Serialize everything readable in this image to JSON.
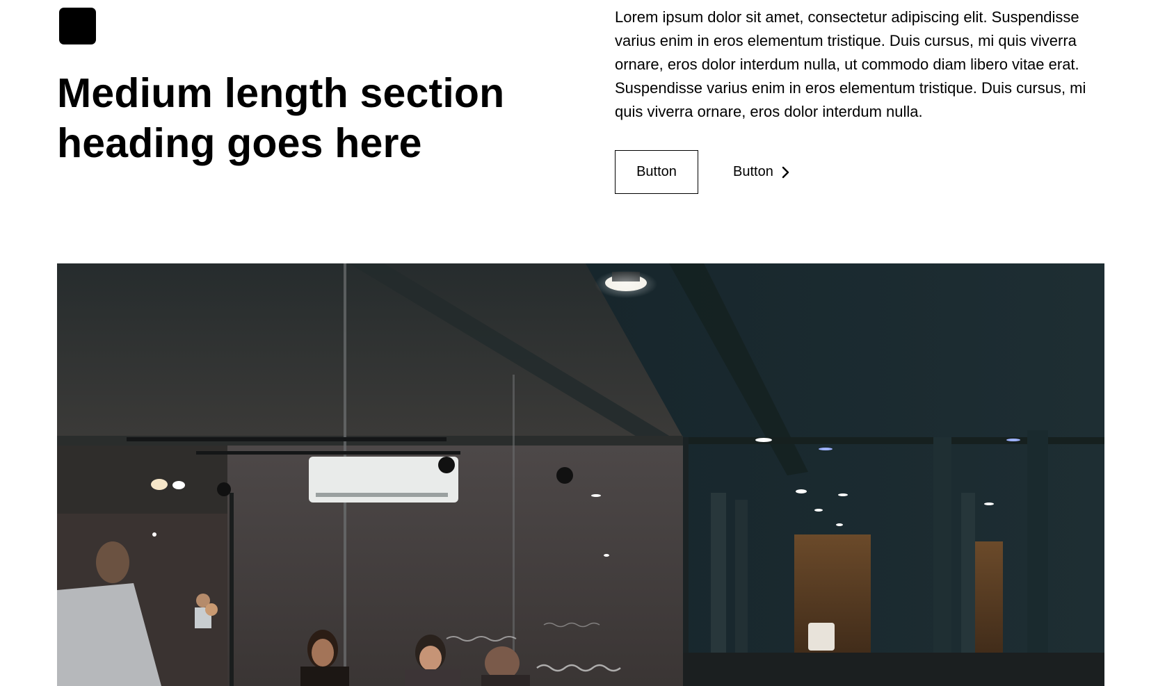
{
  "header": {
    "heading": "Medium length section heading goes here",
    "body": "Lorem ipsum dolor sit amet, consectetur adipiscing elit. Suspendisse varius enim in eros elementum tristique. Duis cursus, mi quis viverra ornare, eros dolor interdum nulla, ut commodo diam libero vitae erat. Suspendisse varius enim in eros elementum tristique. Duis cursus, mi quis viverra ornare, eros dolor interdum nulla.",
    "primary_button": "Button",
    "secondary_button": "Button"
  },
  "icons": {
    "logo": "square-logo-icon",
    "secondary_button_icon": "chevron-right-icon"
  },
  "colors": {
    "text": "#000000",
    "background": "#ffffff",
    "photo_dark": "#1b2327"
  },
  "image": {
    "subject": "office-meeting-room-photo"
  }
}
